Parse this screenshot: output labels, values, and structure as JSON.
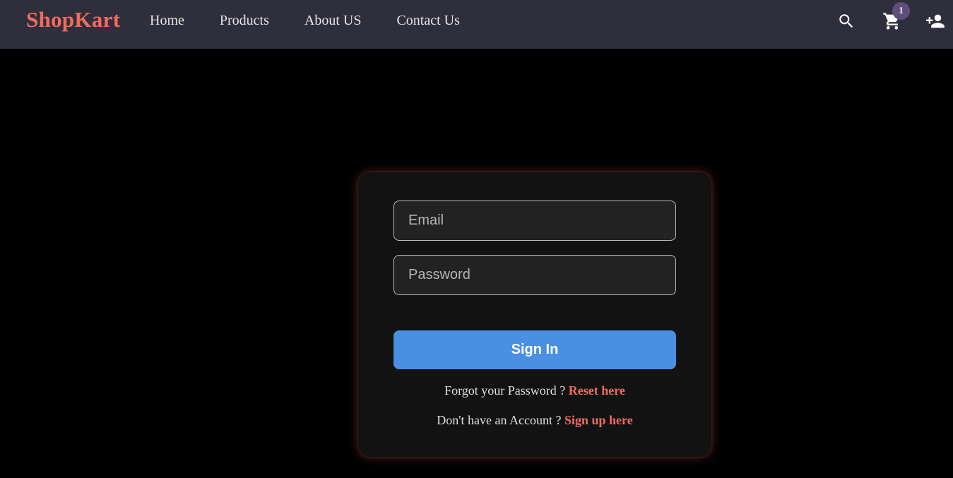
{
  "colors": {
    "navbar_bg": "#2f2e3d",
    "brand": "#f26b5e",
    "accent_link": "#f26b5e",
    "button": "#4a90e2",
    "card_bg": "#121212",
    "badge_bg": "#5d4e7a"
  },
  "navbar": {
    "brand": "ShopKart",
    "links": [
      {
        "label": "Home"
      },
      {
        "label": "Products"
      },
      {
        "label": "About US"
      },
      {
        "label": "Contact Us"
      }
    ],
    "icons": {
      "search": "search-icon",
      "cart": "cart-icon",
      "cart_count": "1",
      "user": "add-user-icon"
    }
  },
  "login": {
    "email_placeholder": "Email",
    "password_placeholder": "Password",
    "submit_label": "Sign In",
    "forgot_text": "Forgot your Password ?",
    "forgot_link": "Reset here",
    "signup_text": "Don't have an Account ?",
    "signup_link": "Sign up here"
  }
}
